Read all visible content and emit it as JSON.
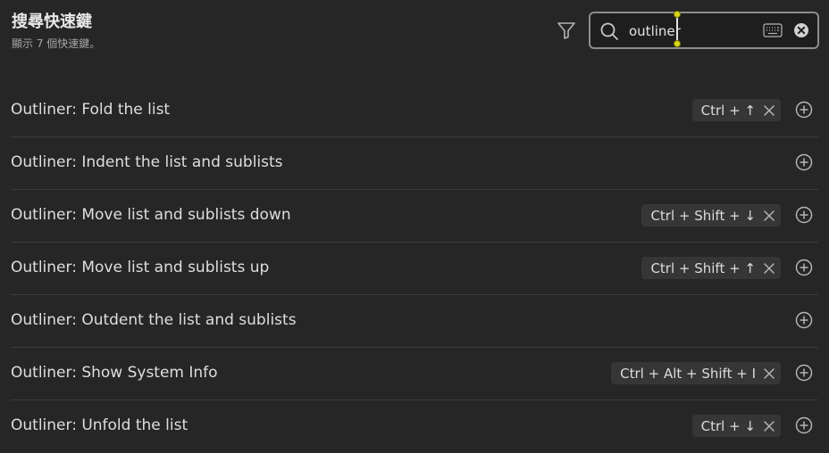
{
  "header": {
    "title": "搜尋快速鍵",
    "count_text": "顯示 7 個快速鍵。"
  },
  "search": {
    "value": "outliner"
  },
  "hotkeys": [
    {
      "label": "Outliner: Fold the list",
      "hotkey": "Ctrl + ↑"
    },
    {
      "label": "Outliner: Indent the list and sublists",
      "hotkey": null
    },
    {
      "label": "Outliner: Move list and sublists down",
      "hotkey": "Ctrl + Shift + ↓"
    },
    {
      "label": "Outliner: Move list and sublists up",
      "hotkey": "Ctrl + Shift + ↑"
    },
    {
      "label": "Outliner: Outdent the list and sublists",
      "hotkey": null
    },
    {
      "label": "Outliner: Show System Info",
      "hotkey": "Ctrl + Alt + Shift + I"
    },
    {
      "label": "Outliner: Unfold the list",
      "hotkey": "Ctrl + ↓"
    }
  ],
  "icons": {
    "filter": "filter-icon",
    "search": "search-icon",
    "keyboard": "keyboard-icon",
    "clear": "clear-icon",
    "remove": "close-icon",
    "add": "plus-circle-icon"
  },
  "colors": {
    "background": "#262626",
    "text": "#dedede",
    "muted": "#a6a6a6",
    "hotkey_bg": "#363636",
    "search_border": "#8c8c8c"
  }
}
